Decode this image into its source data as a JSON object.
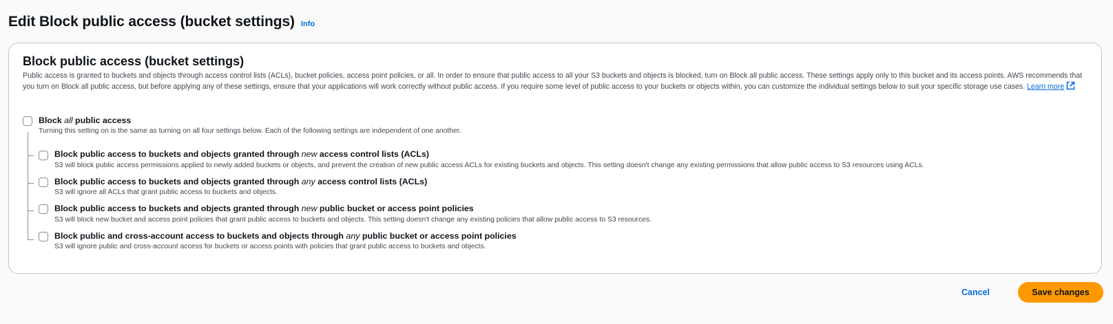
{
  "header": {
    "title": "Edit Block public access (bucket settings)",
    "info": "Info"
  },
  "panel": {
    "title": "Block public access (bucket settings)",
    "description": "Public access is granted to buckets and objects through access control lists (ACLs), bucket policies, access point policies, or all. In order to ensure that public access to all your S3 buckets and objects is blocked, turn on Block all public access. These settings apply only to this bucket and its access points. AWS recommends that you turn on Block all public access, but before applying any of these settings, ensure that your applications will work correctly without public access. If you require some level of public access to your buckets or objects within, you can customize the individual settings below to suit your specific storage use cases.",
    "learn_more": "Learn more",
    "learn_more_icon": "external-link-icon"
  },
  "block_all": {
    "label_pre": "Block ",
    "label_em": "all",
    "label_post": " public access",
    "description": "Turning this setting on is the same as turning on all four settings below. Each of the following settings are independent of one another.",
    "checked": false
  },
  "options": [
    {
      "label_pre": "Block public access to buckets and objects granted through ",
      "label_em": "new",
      "label_post": " access control lists (ACLs)",
      "description": "S3 will block public access permissions applied to newly added buckets or objects, and prevent the creation of new public access ACLs for existing buckets and objects. This setting doesn't change any existing permissions that allow public access to S3 resources using ACLs.",
      "checked": false
    },
    {
      "label_pre": "Block public access to buckets and objects granted through ",
      "label_em": "any",
      "label_post": " access control lists (ACLs)",
      "description": "S3 will ignore all ACLs that grant public access to buckets and objects.",
      "checked": false
    },
    {
      "label_pre": "Block public access to buckets and objects granted through ",
      "label_em": "new",
      "label_post": " public bucket or access point policies",
      "description": "S3 will block new bucket and access point policies that grant public access to buckets and objects. This setting doesn't change any existing policies that allow public access to S3 resources.",
      "checked": false
    },
    {
      "label_pre": "Block public and cross-account access to buckets and objects through ",
      "label_em": "any",
      "label_post": " public bucket or access point policies",
      "description": "S3 will ignore public and cross-account access for buckets or access points with policies that grant public access to buckets and objects.",
      "checked": false
    }
  ],
  "footer": {
    "cancel": "Cancel",
    "save": "Save changes"
  },
  "colors": {
    "primary_button": "#ff9900",
    "link": "#006ce0",
    "border": "#c6c6cd"
  }
}
